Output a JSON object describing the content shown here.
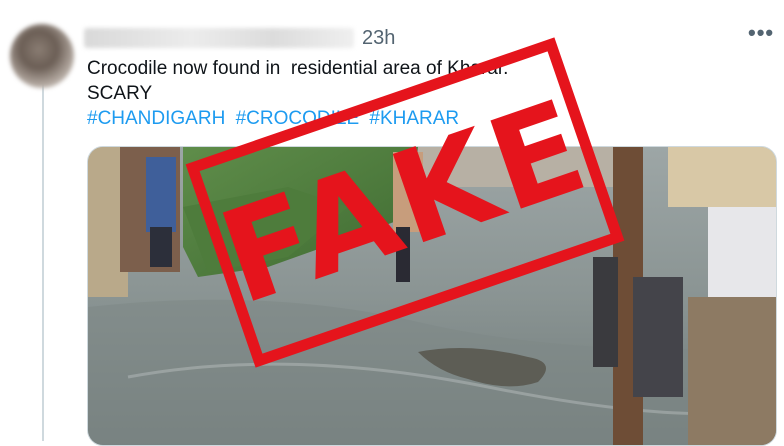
{
  "tweet": {
    "timestamp": "23h",
    "more_icon": "more-horizontal-icon",
    "text_line1": "Crocodile now found in  residential area of Kharar.",
    "text_line2": "SCARY",
    "hashtags": [
      "#CHANDIGARH",
      "#CROCODILE",
      "#KHARAR"
    ]
  },
  "overlay": {
    "stamp_text": "FAKE",
    "stamp_color": "#e5141c"
  },
  "colors": {
    "link": "#1d9bf0",
    "muted": "#536471",
    "text": "#0f1419"
  }
}
